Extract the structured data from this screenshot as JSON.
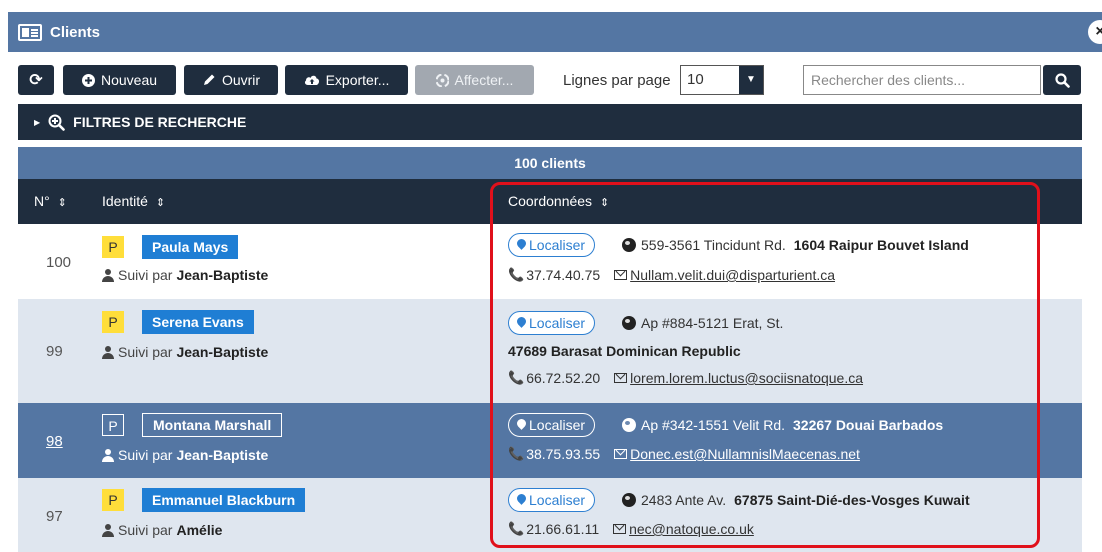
{
  "window": {
    "title": "Clients",
    "close_symbol": "×"
  },
  "toolbar": {
    "refresh_symbol": "⟳",
    "new_label": "Nouveau",
    "open_label": "Ouvrir",
    "export_label": "Exporter...",
    "assign_label": "Affecter...",
    "lines_label": "Lignes par page",
    "lines_value": "10",
    "search_placeholder": "Rechercher des clients..."
  },
  "filters": {
    "label": "FILTRES DE RECHERCHE"
  },
  "summary": {
    "count": "100 clients"
  },
  "table": {
    "headers": {
      "num": "N°",
      "identity": "Identité",
      "contact": "Coordonnées"
    },
    "sort_symbol": "⇕",
    "rows": [
      {
        "num": "100",
        "badge": "P",
        "name": "Paula Mays",
        "follow_prefix": "Suivi par",
        "follow_by": "Jean-Baptiste",
        "locate": "Localiser",
        "address": "559-3561 Tincidunt Rd.",
        "city": "1604 Raipur Bouvet Island",
        "phone": "37.74.40.75",
        "email": "Nullam.velit.dui@disparturient.ca"
      },
      {
        "num": "99",
        "badge": "P",
        "name": "Serena Evans",
        "follow_prefix": "Suivi par",
        "follow_by": "Jean-Baptiste",
        "locate": "Localiser",
        "address": "Ap #884-5121 Erat, St.",
        "city": "47689 Barasat Dominican Republic",
        "phone": "66.72.52.20",
        "email": "lorem.lorem.luctus@sociisnatoque.ca"
      },
      {
        "num": "98",
        "badge": "P",
        "name": "Montana Marshall",
        "follow_prefix": "Suivi par",
        "follow_by": "Jean-Baptiste",
        "locate": "Localiser",
        "address": "Ap #342-1551 Velit Rd.",
        "city": "32267 Douai Barbados",
        "phone": "38.75.93.55",
        "email": "Donec.est@NullamnislMaecenas.net"
      },
      {
        "num": "97",
        "badge": "P",
        "name": "Emmanuel Blackburn",
        "follow_prefix": "Suivi par",
        "follow_by": "Amélie",
        "locate": "Localiser",
        "address": "2483 Ante Av.",
        "city": "67875 Saint-Dié-des-Vosges Kuwait",
        "phone": "21.66.61.11",
        "email": "nec@natoque.co.uk"
      }
    ]
  },
  "colors": {
    "dark": "#1f2d3e",
    "steel": "#5476a3",
    "accent": "#1f7ed4",
    "badge": "#ffde3a",
    "highlight": "#e0101b"
  }
}
